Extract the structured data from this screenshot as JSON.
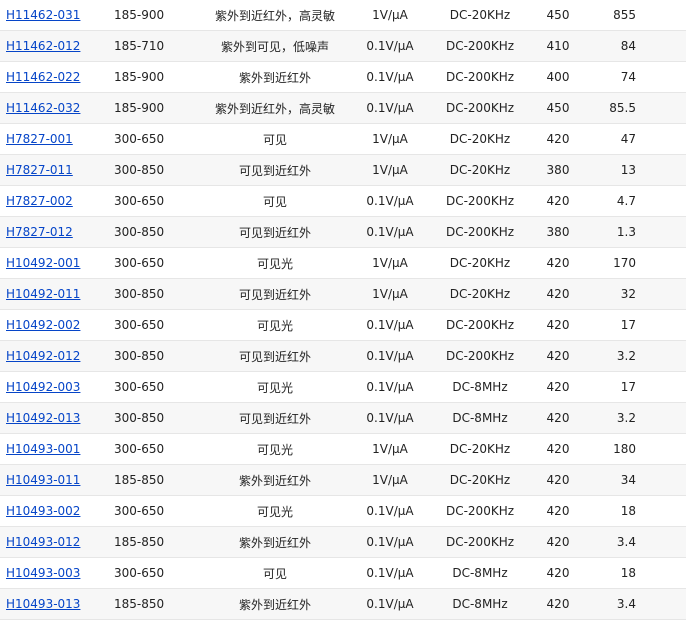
{
  "products": {
    "rows": [
      {
        "model": "H11462-031",
        "range": "185-900",
        "feature": "紫外到近红外，高灵敏",
        "sensitivity": "1V/μA",
        "bandwidth": "DC-20KHz",
        "peak": "450",
        "gain": "855"
      },
      {
        "model": "H11462-012",
        "range": "185-710",
        "feature": "紫外到可见，低噪声",
        "sensitivity": "0.1V/μA",
        "bandwidth": "DC-200KHz",
        "peak": "410",
        "gain": "84"
      },
      {
        "model": "H11462-022",
        "range": "185-900",
        "feature": "紫外到近红外",
        "sensitivity": "0.1V/μA",
        "bandwidth": "DC-200KHz",
        "peak": "400",
        "gain": "74"
      },
      {
        "model": "H11462-032",
        "range": "185-900",
        "feature": "紫外到近红外，高灵敏",
        "sensitivity": "0.1V/μA",
        "bandwidth": "DC-200KHz",
        "peak": "450",
        "gain": "85.5"
      },
      {
        "model": "H7827-001",
        "range": "300-650",
        "feature": "可见",
        "sensitivity": "1V/μA",
        "bandwidth": "DC-20KHz",
        "peak": "420",
        "gain": "47"
      },
      {
        "model": "H7827-011",
        "range": "300-850",
        "feature": "可见到近红外",
        "sensitivity": "1V/μA",
        "bandwidth": "DC-20KHz",
        "peak": "380",
        "gain": "13"
      },
      {
        "model": "H7827-002",
        "range": "300-650",
        "feature": "可见",
        "sensitivity": "0.1V/μA",
        "bandwidth": "DC-200KHz",
        "peak": "420",
        "gain": "4.7"
      },
      {
        "model": "H7827-012",
        "range": "300-850",
        "feature": "可见到近红外",
        "sensitivity": "0.1V/μA",
        "bandwidth": "DC-200KHz",
        "peak": "380",
        "gain": "1.3"
      },
      {
        "model": "H10492-001",
        "range": "300-650",
        "feature": "可见光",
        "sensitivity": "1V/μA",
        "bandwidth": "DC-20KHz",
        "peak": "420",
        "gain": "170"
      },
      {
        "model": "H10492-011",
        "range": "300-850",
        "feature": "可见到近红外",
        "sensitivity": "1V/μA",
        "bandwidth": "DC-20KHz",
        "peak": "420",
        "gain": "32"
      },
      {
        "model": "H10492-002",
        "range": "300-650",
        "feature": "可见光",
        "sensitivity": "0.1V/μA",
        "bandwidth": "DC-200KHz",
        "peak": "420",
        "gain": "17"
      },
      {
        "model": "H10492-012",
        "range": "300-850",
        "feature": "可见到近红外",
        "sensitivity": "0.1V/μA",
        "bandwidth": "DC-200KHz",
        "peak": "420",
        "gain": "3.2"
      },
      {
        "model": "H10492-003",
        "range": "300-650",
        "feature": "可见光",
        "sensitivity": "0.1V/μA",
        "bandwidth": "DC-8MHz",
        "peak": "420",
        "gain": "17"
      },
      {
        "model": "H10492-013",
        "range": "300-850",
        "feature": "可见到近红外",
        "sensitivity": "0.1V/μA",
        "bandwidth": "DC-8MHz",
        "peak": "420",
        "gain": "3.2"
      },
      {
        "model": "H10493-001",
        "range": "300-650",
        "feature": "可见光",
        "sensitivity": "1V/μA",
        "bandwidth": "DC-20KHz",
        "peak": "420",
        "gain": "180"
      },
      {
        "model": "H10493-011",
        "range": "185-850",
        "feature": "紫外到近红外",
        "sensitivity": "1V/μA",
        "bandwidth": "DC-20KHz",
        "peak": "420",
        "gain": "34"
      },
      {
        "model": "H10493-002",
        "range": "300-650",
        "feature": "可见光",
        "sensitivity": "0.1V/μA",
        "bandwidth": "DC-200KHz",
        "peak": "420",
        "gain": "18"
      },
      {
        "model": "H10493-012",
        "range": "185-850",
        "feature": "紫外到近红外",
        "sensitivity": "0.1V/μA",
        "bandwidth": "DC-200KHz",
        "peak": "420",
        "gain": "3.4"
      },
      {
        "model": "H10493-003",
        "range": "300-650",
        "feature": "可见",
        "sensitivity": "0.1V/μA",
        "bandwidth": "DC-8MHz",
        "peak": "420",
        "gain": "18"
      },
      {
        "model": "H10493-013",
        "range": "185-850",
        "feature": "紫外到近红外",
        "sensitivity": "0.1V/μA",
        "bandwidth": "DC-8MHz",
        "peak": "420",
        "gain": "3.4"
      }
    ]
  },
  "colors": {
    "link": "#0645c8",
    "row_alt": "#f7f7f7",
    "divider": "#e6e6e6"
  }
}
